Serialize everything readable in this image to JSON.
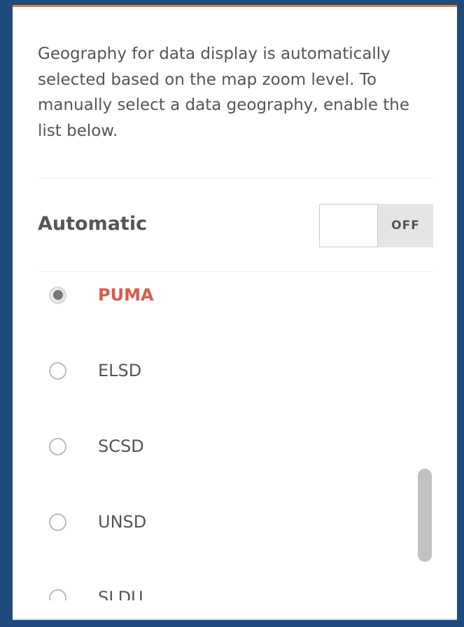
{
  "panel": {
    "description": "Geography for data display is automatically selected based on the map zoom level. To manually select a data geography, enable the list below."
  },
  "automatic": {
    "label": "Automatic",
    "toggle_state": "OFF"
  },
  "geographies": {
    "items": [
      {
        "label": "PUMA",
        "selected": true
      },
      {
        "label": "ELSD",
        "selected": false
      },
      {
        "label": "SCSD",
        "selected": false
      },
      {
        "label": "UNSD",
        "selected": false
      },
      {
        "label": "SLDU",
        "selected": false
      }
    ]
  },
  "colors": {
    "frame_background": "#1f4a7e",
    "selected_item": "#d85c4f",
    "text": "#555555"
  }
}
